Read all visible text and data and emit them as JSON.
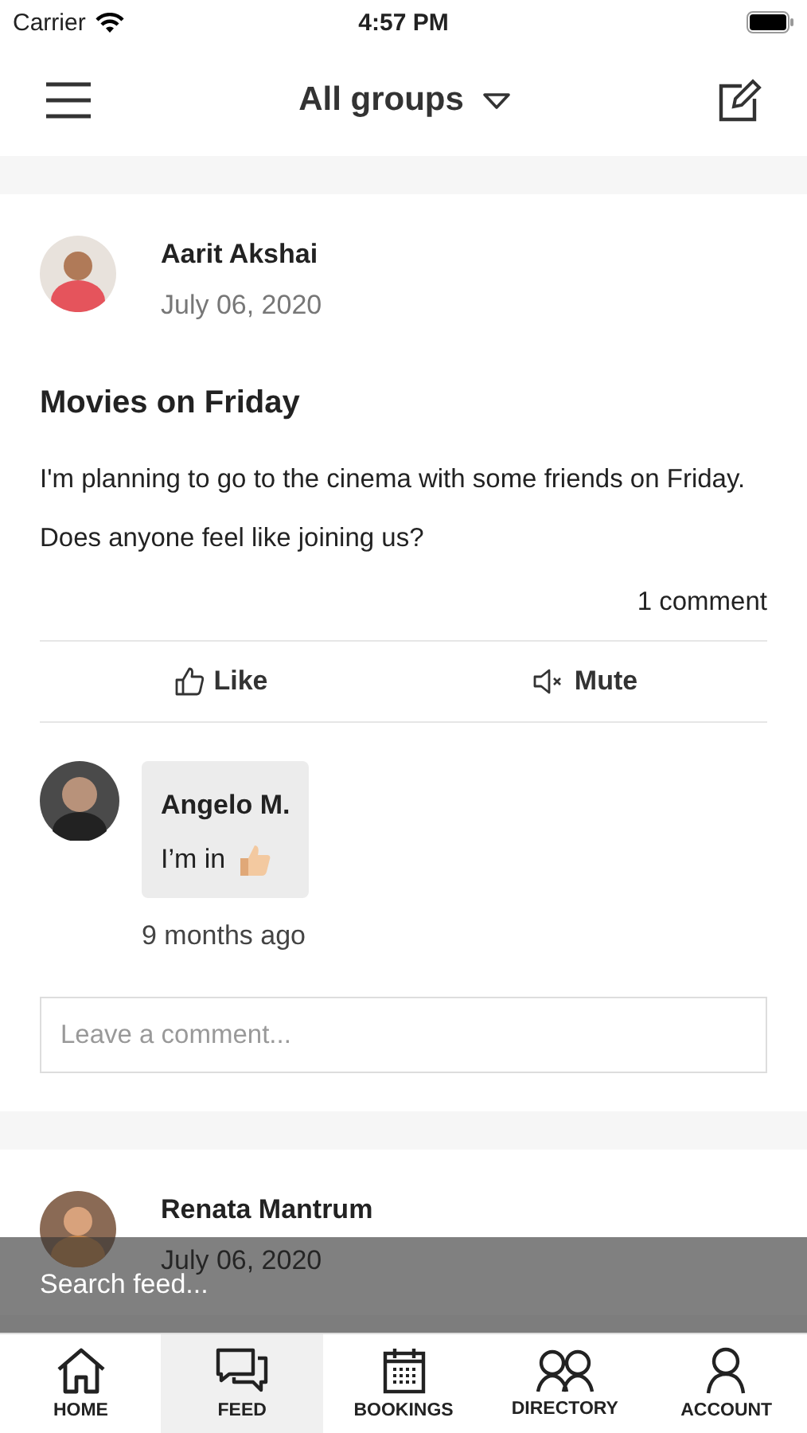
{
  "status_bar": {
    "carrier": "Carrier",
    "time": "4:57 PM"
  },
  "header": {
    "title": "All groups"
  },
  "posts": [
    {
      "author": "Aarit Akshai",
      "date": "July 06, 2020",
      "title": "Movies on Friday",
      "body": "I'm planning to go to the cinema with some friends on Friday. Does anyone feel like joining us?",
      "comment_count": "1 comment",
      "actions": [
        {
          "kind": "like",
          "label": "Like"
        },
        {
          "kind": "mute",
          "label": "Mute"
        }
      ],
      "comments": [
        {
          "author": "Angelo M.",
          "text": "I’m in",
          "time": "9 months ago"
        }
      ],
      "comment_placeholder": "Leave a comment..."
    },
    {
      "author": "Renata Mantrum",
      "date": "July 06, 2020"
    }
  ],
  "search": {
    "placeholder": "Search feed..."
  },
  "tabs": [
    {
      "kind": "home",
      "label": "HOME",
      "selected": false
    },
    {
      "kind": "feed",
      "label": "FEED",
      "selected": true
    },
    {
      "kind": "bookings",
      "label": "BOOKINGS",
      "selected": false
    },
    {
      "kind": "directory",
      "label": "DIRECTORY",
      "selected": false
    },
    {
      "kind": "account",
      "label": "ACCOUNT",
      "selected": false
    }
  ]
}
